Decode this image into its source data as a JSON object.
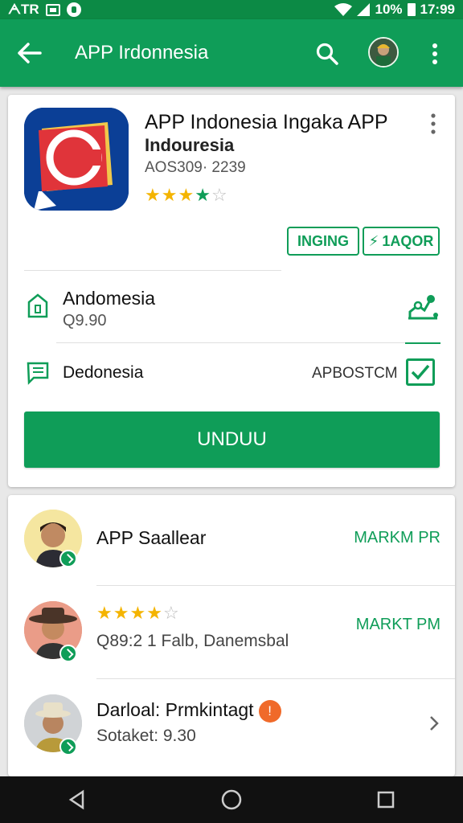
{
  "status_bar": {
    "left_text": "ᗅTR",
    "battery": "10%",
    "time": "17:99"
  },
  "app_bar": {
    "title": "APP Irdonnesia"
  },
  "app": {
    "name": "APP Indonesia Ingaka APP",
    "developer": "Indouresia",
    "meta": "AOS309· 2239",
    "rating": 3.5,
    "tags": [
      "INGING",
      "1AQOR"
    ],
    "tag2_prefix": "⚡"
  },
  "info_rows": [
    {
      "title": "Andomesia",
      "subtitle": "Q9.90"
    },
    {
      "title": "Dedonesia",
      "right_text": "APBOSTCM"
    }
  ],
  "install_button": "UNDUU",
  "list": [
    {
      "title": "APP Saallear",
      "action": "MARKM PR"
    },
    {
      "rating": 3.5,
      "subtitle": "Q89:2 1 Falb, Danemsbal",
      "action": "MARKT PM"
    },
    {
      "title": "Darloal: Prmkintagt",
      "badge": "!",
      "subtitle": "Sotaket: 9.30"
    }
  ],
  "colors": {
    "primary": "#0f9d58",
    "status_bar": "#0c8a45",
    "star": "#f4b400",
    "orange": "#f06a2a"
  }
}
